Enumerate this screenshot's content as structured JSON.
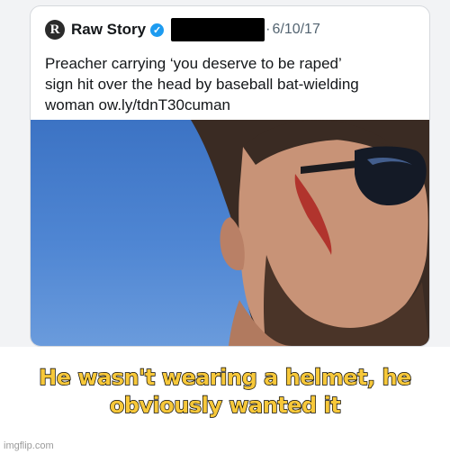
{
  "tweet": {
    "logo_letter": "R",
    "account_name": "Raw Story",
    "verified_mark": "✓",
    "separator": "·",
    "date": "6/10/17",
    "text_lines": [
      "Preacher carrying ‘you deserve to be raped’",
      "sign hit over the head by baseball bat-wielding",
      "woman ow.ly/tdnT30cuman"
    ],
    "photo_icon": "man-with-sunglasses-photo"
  },
  "meme": {
    "caption_lines": [
      "He wasn't wearing a helmet, he",
      "obviously wanted it"
    ],
    "caption_color": "#f7c83a"
  },
  "watermark": "imgflip.com"
}
